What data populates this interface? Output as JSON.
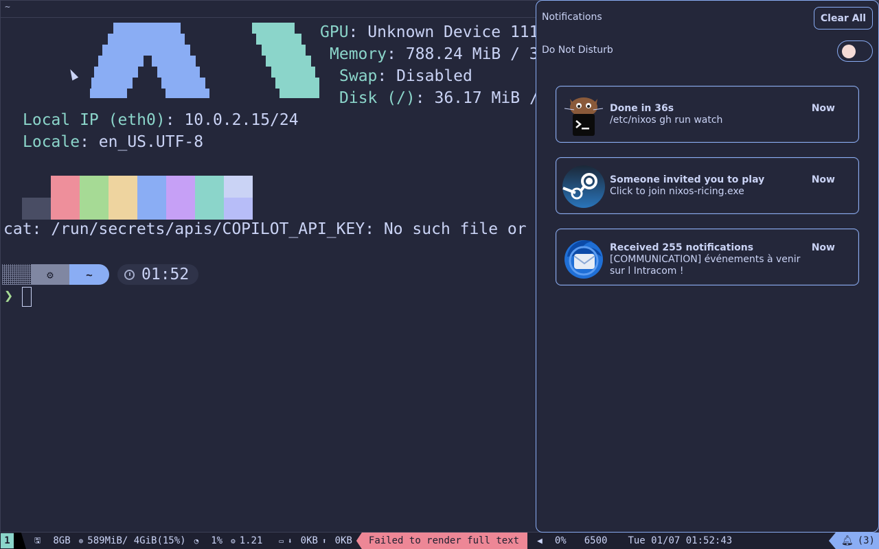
{
  "terminal": {
    "title": "~",
    "info": {
      "gpu_key": "GPU",
      "gpu_value": ": Unknown Device 111",
      "memory_key": "Memory",
      "memory_value": ": 788.24 MiB / 3",
      "swap_key": "Swap",
      "swap_value": ": Disabled",
      "disk_key": "Disk (/)",
      "disk_value": ": 36.17 MiB /",
      "ip_key": "Local IP (eth0)",
      "ip_value": ": 10.0.2.15/24",
      "locale_key": "Locale",
      "locale_value": ": en_US.UTF-8"
    },
    "palette_top": [
      "#ee8f9b",
      "#a6da95",
      "#eed49f",
      "#8aadf4",
      "#c6a0f6",
      "#8bd5ca",
      "#cad3f5"
    ],
    "palette_bottom": [
      "#494d64",
      "#ee8f9b",
      "#a6da95",
      "#eed49f",
      "#8aadf4",
      "#c6a0f6",
      "#8bd5ca",
      "#b7bdf8"
    ],
    "error_line": "cat: /run/secrets/apis/COPILOT_API_KEY: No such file or",
    "prompt": {
      "gear_icon": "⚙",
      "dir": "~",
      "time": "01:52",
      "char": "❯"
    }
  },
  "notifications": {
    "title": "Notifications",
    "clear_all": "Clear All",
    "dnd_label": "Do Not Disturb",
    "dnd_enabled": false,
    "items": [
      {
        "icon": "terminal-cat-icon",
        "summary": "Done in 36s",
        "body": "/etc/nixos gh run watch",
        "time": "Now"
      },
      {
        "icon": "steam-icon",
        "summary": "Someone invited you to play",
        "body": "Click to join nixos-ricing.exe",
        "time": "Now"
      },
      {
        "icon": "thunderbird-icon",
        "summary": "Received 255 notifications",
        "body": "[COMMUNICATION] événements à venir sur l Intracom !",
        "time": "Now"
      }
    ]
  },
  "statusbar": {
    "workspace": "1",
    "disk": "8GB",
    "memory": "589MiB/ 4GiB(15%)",
    "cpu": "1%",
    "load": "1.21",
    "net_down": "0KB",
    "net_up": "0KB",
    "error": "Failed to render full text",
    "volume": "0%",
    "temperature": "6500",
    "datetime": "Tue 01/07 01:52:43",
    "notif_count": "(3)"
  },
  "colors": {
    "accent": "#8aadf4",
    "teal": "#8bd5ca",
    "green": "#a6da95",
    "red": "#ed8796",
    "background": "#24273a"
  }
}
